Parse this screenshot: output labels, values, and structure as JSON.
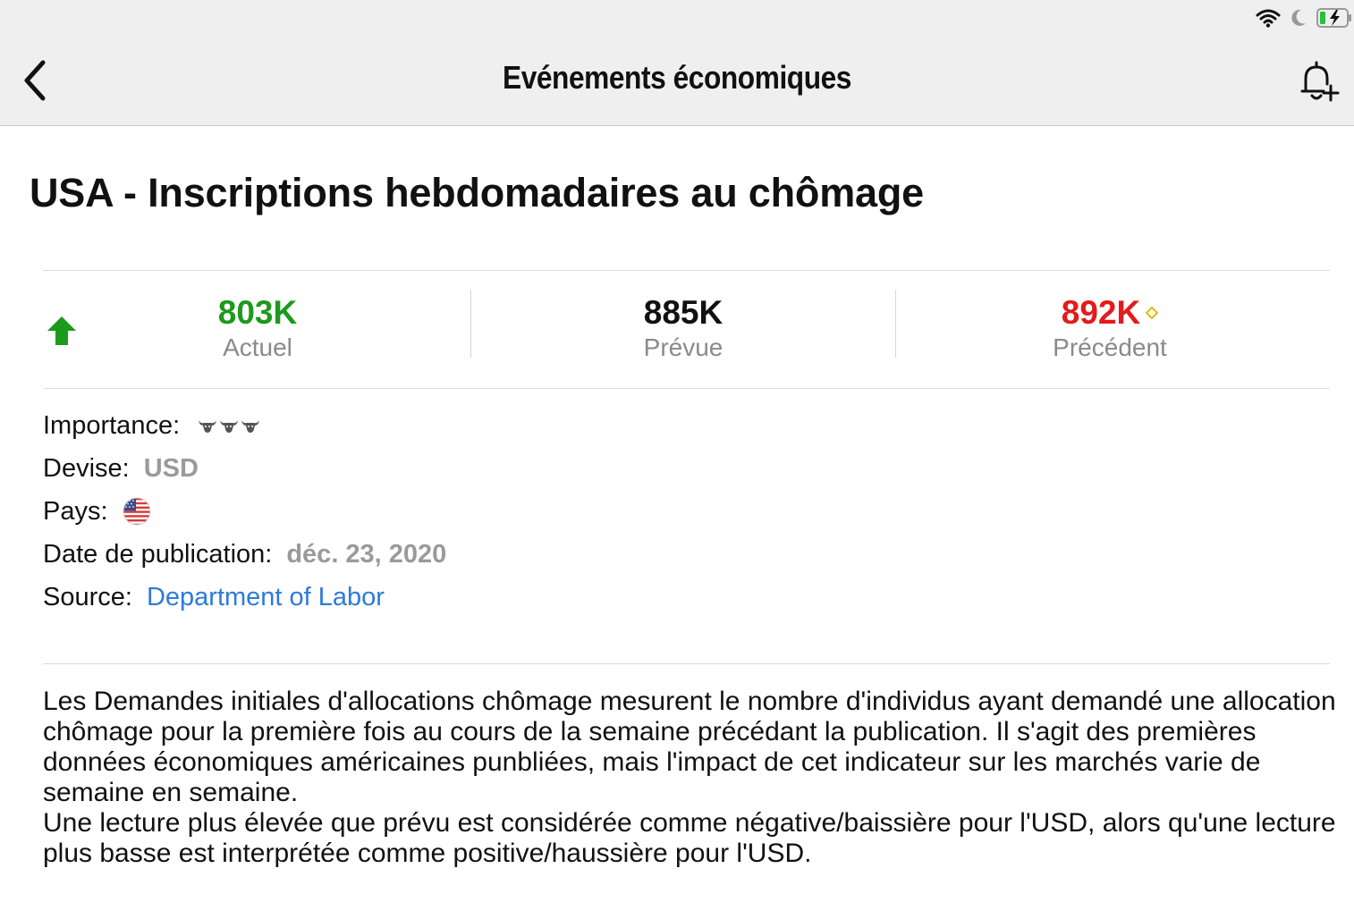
{
  "header": {
    "title": "Evénements économiques"
  },
  "event": {
    "title": "USA - Inscriptions hebdomadaires au chômage"
  },
  "stats": {
    "actual": {
      "value": "803K",
      "label": "Actuel",
      "color": "#1c9a1c"
    },
    "forecast": {
      "value": "885K",
      "label": "Prévue",
      "color": "#111111"
    },
    "previous": {
      "value": "892K",
      "label": "Précédent",
      "color": "#e31b1b"
    }
  },
  "details": {
    "importance_label": "Importance:",
    "currency_label": "Devise:",
    "currency_value": "USD",
    "country_label": "Pays:",
    "date_label": "Date de publication:",
    "date_value": "déc. 23, 2020",
    "source_label": "Source:",
    "source_value": "Department of Labor"
  },
  "description": {
    "paragraph1": "Les Demandes initiales d'allocations chômage mesurent le nombre d'individus ayant demandé une allocation chômage pour la première fois au cours de la semaine précédant la publication. Il s'agit des premières données économiques américaines punbliées, mais l'impact de cet indicateur sur les marchés varie de semaine en semaine.",
    "paragraph2": "Une lecture plus élevée que prévu est considérée comme négative/baissière pour l'USD, alors qu'une lecture plus basse est interprétée comme positive/haussière pour l'USD."
  },
  "icons": {
    "wifi": "wifi-icon",
    "moon": "moon-icon",
    "battery": "battery-charging-icon",
    "back": "chevron-left-icon",
    "alert": "bell-plus-icon",
    "trend": "arrow-up-icon",
    "revision": "diamond-icon",
    "importance": "bull-icon",
    "flag": "us-flag-icon"
  },
  "colors": {
    "accent_link": "#2e7ad9",
    "up": "#1c9a1c",
    "down": "#e31b1b"
  }
}
